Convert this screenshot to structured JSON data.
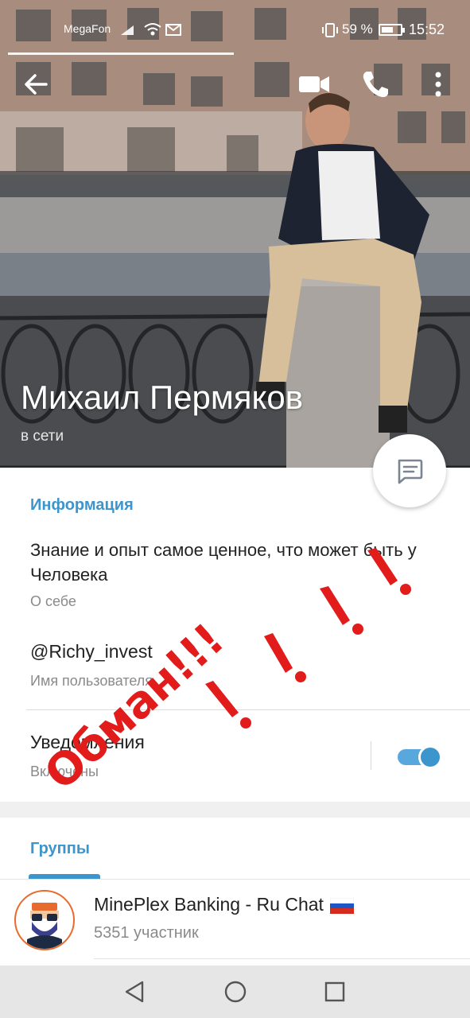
{
  "status_bar": {
    "carrier": "MegaFon",
    "battery_percent": "59 %",
    "time": "15:52"
  },
  "profile": {
    "name": "Михаил Пермяков",
    "status": "в сети"
  },
  "info": {
    "section_title": "Информация",
    "bio": "Знание и опыт самое ценное, что может быть у Человека",
    "bio_label": "О себе",
    "username": "@Richy_invest",
    "username_label": "Имя пользователя",
    "notifications_label": "Уведомления",
    "notifications_state": "Включены",
    "notifications_on": true
  },
  "groups": {
    "section_title": "Группы",
    "items": [
      {
        "name": "MinePlex Banking - Ru Chat",
        "members": "5351 участник"
      }
    ]
  },
  "annotation": {
    "text": "Обман!!!",
    "color": "#e21b1b"
  },
  "colors": {
    "accent": "#3d95ce",
    "text": "#222222",
    "secondary_text": "#8a8a8a"
  },
  "icons": [
    "back-arrow-icon",
    "video-call-icon",
    "phone-icon",
    "more-vert-icon",
    "message-icon",
    "back-triangle-icon",
    "home-circle-icon",
    "recent-square-icon"
  ]
}
